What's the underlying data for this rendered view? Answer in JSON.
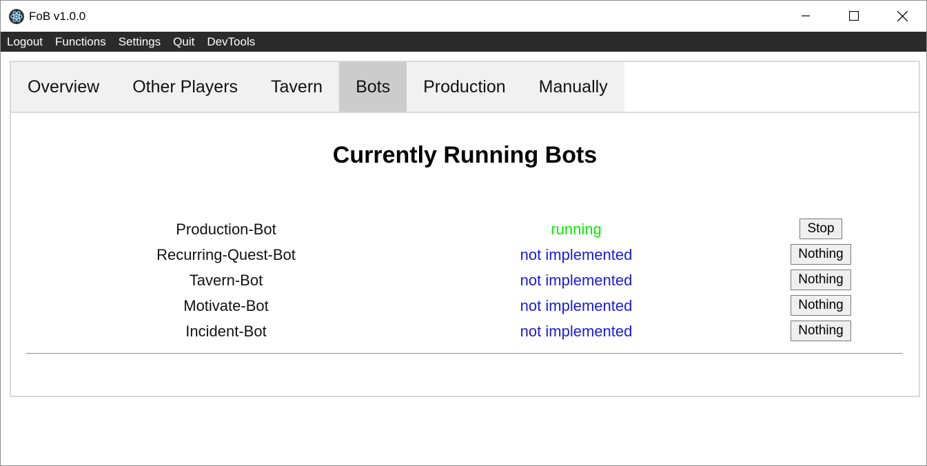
{
  "window": {
    "title": "FoB v1.0.0",
    "icon": "electron-atom-icon"
  },
  "menu": {
    "items": [
      "Logout",
      "Functions",
      "Settings",
      "Quit",
      "DevTools"
    ]
  },
  "tabs": {
    "items": [
      "Overview",
      "Other Players",
      "Tavern",
      "Bots",
      "Production",
      "Manually"
    ],
    "active": "Bots"
  },
  "heading": "Currently Running Bots",
  "bots": [
    {
      "name": "Production-Bot",
      "status": "running",
      "action": "Stop"
    },
    {
      "name": "Recurring-Quest-Bot",
      "status": "not implemented",
      "action": "Nothing"
    },
    {
      "name": "Tavern-Bot",
      "status": "not implemented",
      "action": "Nothing"
    },
    {
      "name": "Motivate-Bot",
      "status": "not implemented",
      "action": "Nothing"
    },
    {
      "name": "Incident-Bot",
      "status": "not implemented",
      "action": "Nothing"
    }
  ],
  "colors": {
    "running": "#00ee00",
    "not_implemented": "#1919e6",
    "menubar": "#2b2b2b",
    "active_tab": "#cccccc"
  }
}
